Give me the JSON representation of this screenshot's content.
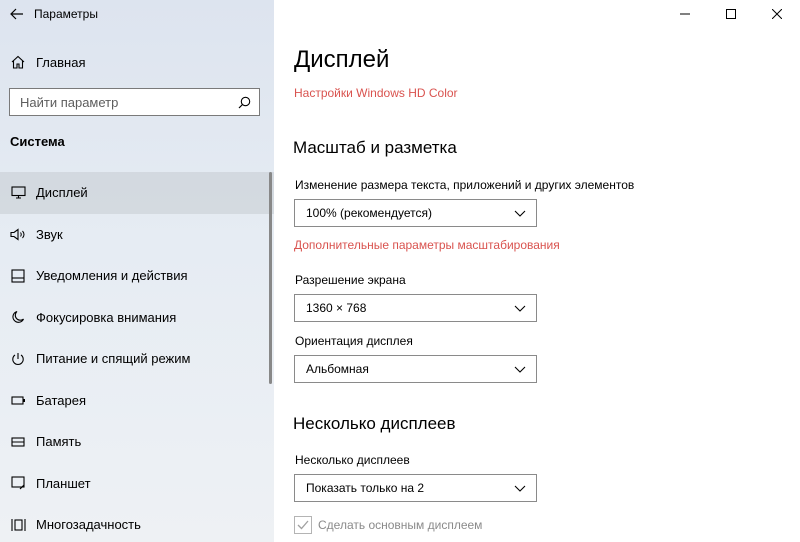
{
  "window": {
    "title": "Параметры"
  },
  "sidebar": {
    "home_label": "Главная",
    "search_placeholder": "Найти параметр",
    "section_label": "Система",
    "items": [
      {
        "label": "Дисплей",
        "icon": "monitor-icon"
      },
      {
        "label": "Звук",
        "icon": "speaker-icon"
      },
      {
        "label": "Уведомления и действия",
        "icon": "notification-icon"
      },
      {
        "label": "Фокусировка внимания",
        "icon": "moon-icon"
      },
      {
        "label": "Питание и спящий режим",
        "icon": "power-icon"
      },
      {
        "label": "Батарея",
        "icon": "battery-icon"
      },
      {
        "label": "Память",
        "icon": "storage-icon"
      },
      {
        "label": "Планшет",
        "icon": "tablet-icon"
      },
      {
        "label": "Многозадачность",
        "icon": "multitasking-icon"
      }
    ],
    "selected_index": 0
  },
  "main": {
    "title": "Дисплей",
    "hd_color_link": "Настройки Windows HD Color",
    "scale_section": {
      "heading": "Масштаб и разметка",
      "scale_label": "Изменение размера текста, приложений и других элементов",
      "scale_value": "100% (рекомендуется)",
      "advanced_link": "Дополнительные параметры масштабирования",
      "resolution_label": "Разрешение экрана",
      "resolution_value": "1360 × 768",
      "orientation_label": "Ориентация дисплея",
      "orientation_value": "Альбомная"
    },
    "multi_section": {
      "heading": "Несколько дисплеев",
      "multi_label": "Несколько дисплеев",
      "multi_value": "Показать только на 2",
      "primary_checkbox_label": "Сделать основным дисплеем",
      "primary_checked": true
    }
  },
  "colors": {
    "accent_link": "#d9534f"
  }
}
